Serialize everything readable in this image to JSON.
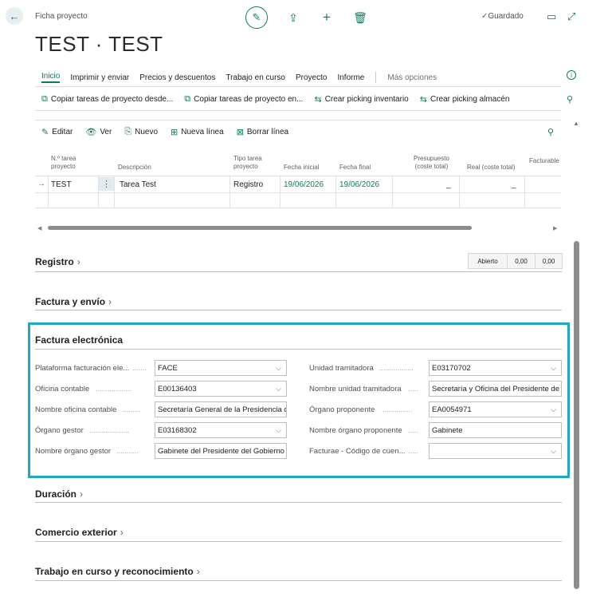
{
  "header": {
    "breadcrumb": "Ficha proyecto",
    "title": "TEST · TEST",
    "saved_status": "Guardado"
  },
  "nav": {
    "tabs": [
      "Inicio",
      "Imprimir y enviar",
      "Precios y descuentos",
      "Trabajo en curso",
      "Proyecto",
      "Informe"
    ],
    "more": "Más opciones"
  },
  "actions": [
    "Copiar tareas de proyecto desde...",
    "Copiar tareas de proyecto en...",
    "Crear picking inventario",
    "Crear picking almacén"
  ],
  "lines": {
    "toolbar": [
      "Editar",
      "Ver",
      "Nuevo",
      "Nueva línea",
      "Borrar línea"
    ],
    "columns": {
      "task_no": [
        "N.º tarea",
        "proyecto"
      ],
      "description": "Descripción",
      "task_type": [
        "Tipo tarea",
        "proyecto"
      ],
      "start_date": "Fecha inicial",
      "end_date": "Fecha final",
      "budget": [
        "Presupuesto",
        "(coste total)"
      ],
      "actual": "Real (coste total)",
      "billable": "Facturable"
    },
    "row": {
      "task_no": "TEST",
      "description": "Tarea Test",
      "task_type": "Registro",
      "start_date": "19/06/2026",
      "end_date": "19/06/2026",
      "budget": "_",
      "actual": "_"
    }
  },
  "sections": {
    "registro": "Registro",
    "factura_envio": "Factura y envío",
    "factura_electronica": "Factura electrónica",
    "duracion": "Duración",
    "comercio_exterior": "Comercio exterior",
    "trabajo_curso": "Trabajo en curso y reconocimiento"
  },
  "status": {
    "state": "Abierto",
    "value1": "0,00",
    "value2": "0,00"
  },
  "einvoice": {
    "left": [
      {
        "label": "Plataforma facturación ele...",
        "value": "FACE",
        "dropdown": true
      },
      {
        "label": "Oficina contable",
        "value": "E00136403",
        "dropdown": true
      },
      {
        "label": "Nombre oficina contable",
        "value": "Secretaría General de la Presidencia d",
        "dropdown": false
      },
      {
        "label": "Órgano gestor",
        "value": "E03168302",
        "dropdown": true
      },
      {
        "label": "Nombre órgano gestor",
        "value": "Gabinete del Presidente del Gobierno",
        "dropdown": false
      }
    ],
    "right": [
      {
        "label": "Unidad tramitadora",
        "value": "E03170702",
        "dropdown": true
      },
      {
        "label": "Nombre unidad tramitadora",
        "value": "Secretaría y Oficina del Presidente de",
        "dropdown": false
      },
      {
        "label": "Órgano proponente",
        "value": "EA0054971",
        "dropdown": true
      },
      {
        "label": "Nombre órgano proponente",
        "value": "Gabinete",
        "dropdown": false
      },
      {
        "label": "Facturae - Código de cuen...",
        "value": "",
        "dropdown": true
      }
    ]
  },
  "colors": {
    "accent": "#0e7a5f",
    "highlight": "#22a6c3"
  }
}
